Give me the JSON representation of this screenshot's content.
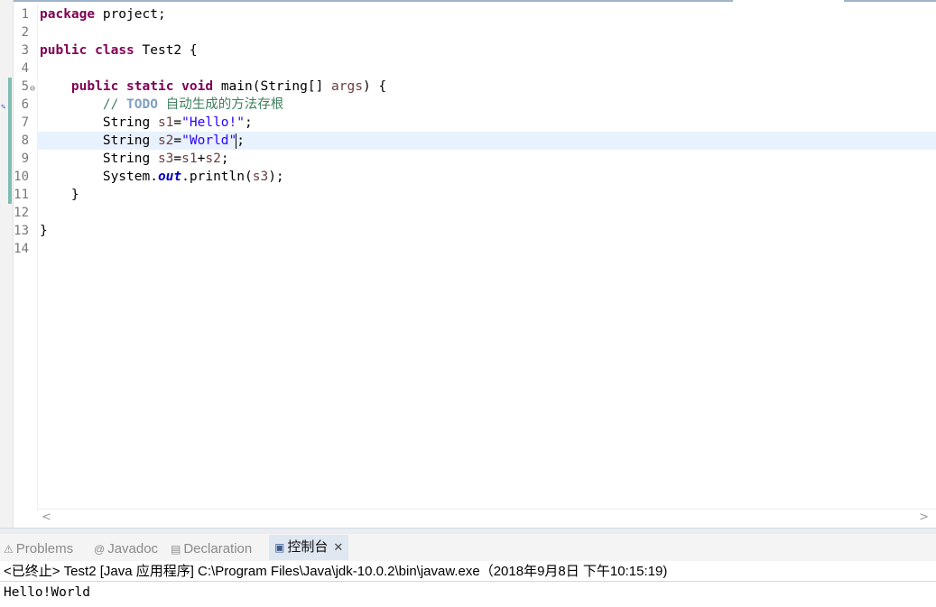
{
  "editor": {
    "lines": [
      {
        "n": "1"
      },
      {
        "n": "2"
      },
      {
        "n": "3"
      },
      {
        "n": "4"
      },
      {
        "n": "5"
      },
      {
        "n": "6"
      },
      {
        "n": "7"
      },
      {
        "n": "8"
      },
      {
        "n": "9"
      },
      {
        "n": "10"
      },
      {
        "n": "11"
      },
      {
        "n": "12"
      },
      {
        "n": "13"
      },
      {
        "n": "14"
      }
    ],
    "code": {
      "l1_kw": "package",
      "l1_rest": " project;",
      "l3_kw1": "public",
      "l3_kw2": "class",
      "l3_rest": " Test2 {",
      "l5_indent": "    ",
      "l5_kw1": "public",
      "l5_kw2": "static",
      "l5_kw3": "void",
      "l5_rest1": " main(String[] ",
      "l5_var": "args",
      "l5_rest2": ") {",
      "l6_indent": "        ",
      "l6_cmt": "// ",
      "l6_todo": "TODO",
      "l6_text": " 自动生成的方法存根",
      "l7_indent": "        ",
      "l7_type": "String ",
      "l7_var": "s1",
      "l7_eq": "=",
      "l7_str": "\"Hello!\"",
      "l7_end": ";",
      "l8_indent": "        ",
      "l8_type": "String ",
      "l8_var": "s2",
      "l8_eq": "=",
      "l8_str": "\"World\"",
      "l8_end": ";",
      "l9_indent": "        ",
      "l9_type": "String ",
      "l9_var1": "s3",
      "l9_eq": "=",
      "l9_var2": "s1",
      "l9_plus": "+",
      "l9_var3": "s2",
      "l9_end": ";",
      "l10_indent": "        ",
      "l10_a": "System.",
      "l10_field": "out",
      "l10_b": ".println(",
      "l10_var": "s3",
      "l10_c": ");",
      "l11": "    }",
      "l13": "}"
    }
  },
  "bottom_tabs": [
    {
      "label": "Problems",
      "icon": "problems-icon"
    },
    {
      "label": "Javadoc",
      "icon": "javadoc-icon"
    },
    {
      "label": "Declaration",
      "icon": "declaration-icon"
    },
    {
      "label": "控制台",
      "icon": "console-icon",
      "active": true
    }
  ],
  "console": {
    "header": "<已终止> Test2 [Java 应用程序] C:\\Program Files\\Java\\jdk-10.0.2\\bin\\javaw.exe（2018年9月8日 下午10:15:19)",
    "output": "Hello!World"
  },
  "colors": {
    "keyword": "#7f0055",
    "string": "#2a00ff",
    "variable": "#6a3e3e",
    "comment": "#3f7f5f",
    "current_line": "#e8f2fe"
  }
}
